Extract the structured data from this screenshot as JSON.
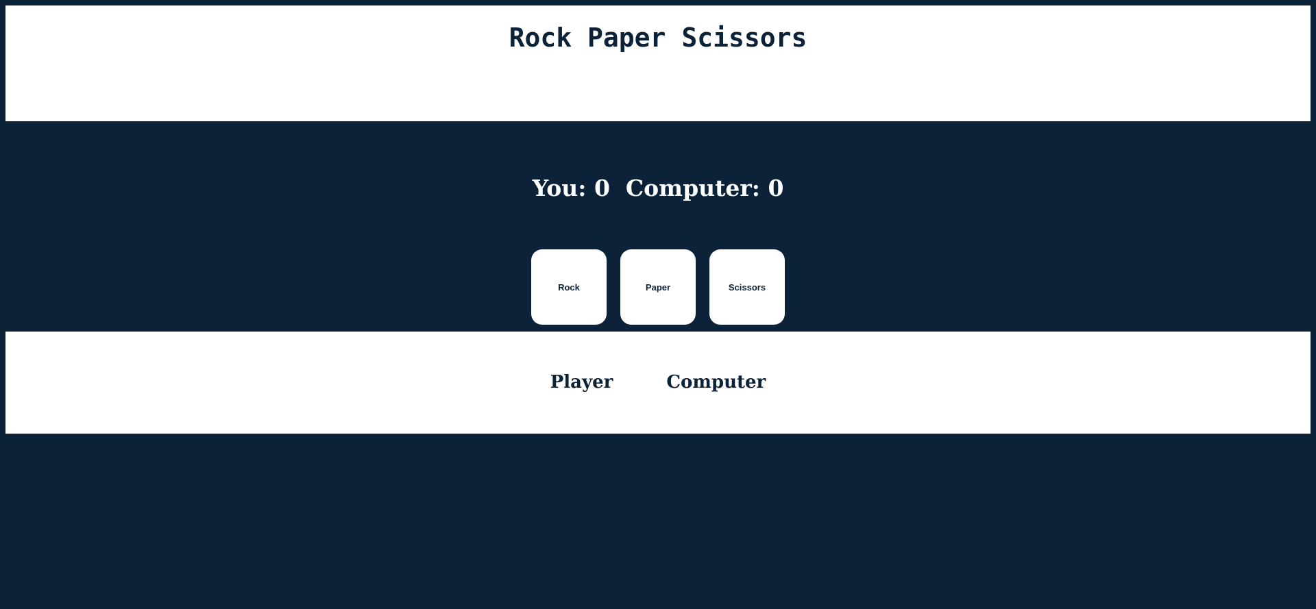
{
  "header": {
    "title": "Rock Paper Scissors"
  },
  "scoreboard": {
    "player_label": "You:",
    "player_score": "0",
    "computer_label": "Computer:",
    "computer_score": "0"
  },
  "choices": [
    {
      "label": "Rock"
    },
    {
      "label": "Paper"
    },
    {
      "label": "Scissors"
    }
  ],
  "results": {
    "player_label": "Player",
    "computer_label": "Computer"
  },
  "colors": {
    "background": "#0b2239",
    "panel": "#ffffff",
    "text_dark": "#0b2239",
    "text_light": "#ffffff"
  }
}
